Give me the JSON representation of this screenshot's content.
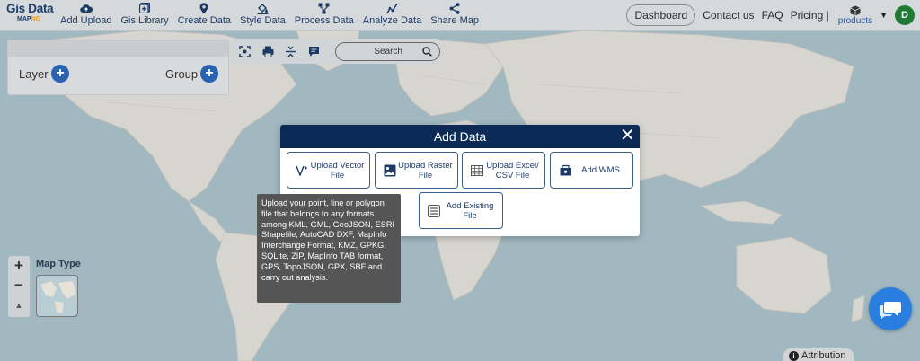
{
  "logo": {
    "top": "Gis Data",
    "bottom_left": "MAP",
    "bottom_right": "NG"
  },
  "nav": [
    {
      "label": "Add Upload",
      "icon": "cloud-upload-icon"
    },
    {
      "label": "Gis Library",
      "icon": "library-icon"
    },
    {
      "label": "Create Data",
      "icon": "map-pin-icon"
    },
    {
      "label": "Style Data",
      "icon": "paint-bucket-icon"
    },
    {
      "label": "Process Data",
      "icon": "process-icon"
    },
    {
      "label": "Analyze Data",
      "icon": "analyze-icon"
    },
    {
      "label": "Share Map",
      "icon": "share-icon"
    }
  ],
  "nav_right": {
    "dashboard": "Dashboard",
    "contact": "Contact us",
    "faq": "FAQ",
    "pricing": "Pricing |",
    "products": "products",
    "avatar": "D"
  },
  "layer_panel": {
    "layer": "Layer",
    "group": "Group"
  },
  "toolbar": {
    "search": "Search"
  },
  "map_type": {
    "label": "Map Type"
  },
  "zoom": {
    "in": "+",
    "out": "−",
    "extra": "▲"
  },
  "modal": {
    "title": "Add Data",
    "close": "✕",
    "options": [
      {
        "label": "Upload Vector File",
        "icon": "vector-icon"
      },
      {
        "label": "Upload Raster File",
        "icon": "raster-icon"
      },
      {
        "label": "Upload Excel/ CSV File",
        "icon": "table-icon"
      },
      {
        "label": "Add WMS",
        "icon": "wms-icon"
      },
      {
        "label": "Add Existing File",
        "icon": "database-icon"
      }
    ]
  },
  "tooltip": "Upload your point, line or polygon file that belongs to any formats among KML, GML, GeoJSON, ESRI Shapefile, AutoCAD DXF, MapInfo Interchange Format, KMZ, GPKG, SQLite, ZIP, MapInfo TAB format, GPS, TopoJSON, GPX, SBF and carry out analysis.",
  "attribution": "Attribution",
  "colors": {
    "navy": "#0b2a55",
    "accent": "#2a62b2",
    "avatar": "#1e7a34",
    "chat": "#2a7ee0"
  }
}
